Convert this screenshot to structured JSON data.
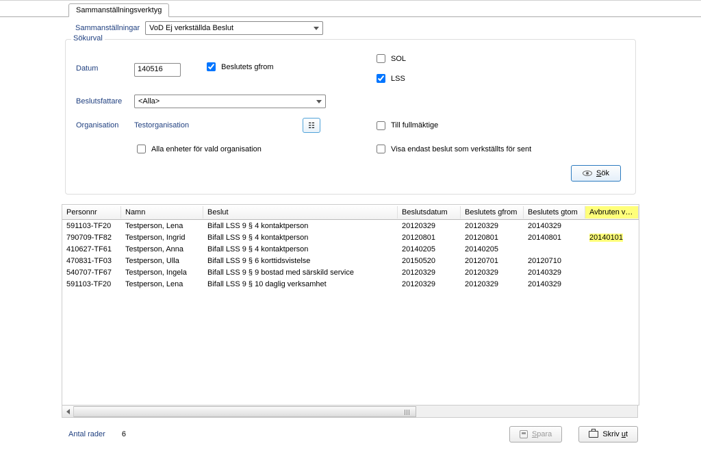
{
  "tab": {
    "title": "Sammanställningsverktyg"
  },
  "toolbar": {
    "compilations_label": "Sammanställningar",
    "compilations_value": "VoD Ej verkställda Beslut"
  },
  "search": {
    "group_title": "Sökurval",
    "date_label": "Datum",
    "date_value": "140516",
    "beslutets_gfrom_label": "Beslutets gfrom",
    "beslutets_gfrom_checked": true,
    "sol_label": "SOL",
    "sol_checked": false,
    "lss_label": "LSS",
    "lss_checked": true,
    "beslutsfattare_label": "Beslutsfattare",
    "beslutsfattare_value": "<Alla>",
    "organisation_label": "Organisation",
    "organisation_link": "Testorganisation",
    "all_units_label": "Alla enheter för vald organisation",
    "all_units_checked": false,
    "till_fullmaktige_label": "Till fullmäktige",
    "till_fullmaktige_checked": false,
    "visa_endast_label": "Visa endast beslut som verkställts för sent",
    "visa_endast_checked": false,
    "search_btn_label": "Sök",
    "search_btn_hotkey": "S"
  },
  "grid": {
    "columns": [
      "Personnr",
      "Namn",
      "Beslut",
      "Beslutsdatum",
      "Beslutets gfrom",
      "Beslutets gtom",
      "Avbruten verkställighet"
    ],
    "highlight_column_index": 6,
    "rows": [
      {
        "personnr": "591103-TF20",
        "namn": "Testperson, Lena",
        "beslut": "Bifall LSS 9 § 4 kontaktperson",
        "beslutsdatum": "20120329",
        "gfrom": "20120329",
        "gtom": "20140329",
        "avbruten": ""
      },
      {
        "personnr": "790709-TF82",
        "namn": "Testperson, Ingrid",
        "beslut": "Bifall LSS 9 § 4 kontaktperson",
        "beslutsdatum": "20120801",
        "gfrom": "20120801",
        "gtom": "20140801",
        "avbruten": "20140101",
        "highlight": true
      },
      {
        "personnr": "410627-TF61",
        "namn": "Testperson,  Anna",
        "beslut": "Bifall LSS 9 § 4 kontaktperson",
        "beslutsdatum": "20140205",
        "gfrom": "20140205",
        "gtom": "",
        "avbruten": ""
      },
      {
        "personnr": "470831-TF03",
        "namn": "Testperson, Ulla",
        "beslut": "Bifall LSS 9 § 6 korttidsvistelse",
        "beslutsdatum": "20150520",
        "gfrom": "20120701",
        "gtom": "20120710",
        "avbruten": ""
      },
      {
        "personnr": "540707-TF67",
        "namn": "Testperson, Ingela",
        "beslut": "Bifall LSS 9 § 9 bostad med särskild service",
        "beslutsdatum": "20120329",
        "gfrom": "20120329",
        "gtom": "20140329",
        "avbruten": ""
      },
      {
        "personnr": "591103-TF20",
        "namn": "Testperson, Lena",
        "beslut": "Bifall LSS 9 § 10 daglig verksamhet",
        "beslutsdatum": "20120329",
        "gfrom": "20120329",
        "gtom": "20140329",
        "avbruten": ""
      }
    ]
  },
  "status": {
    "count_label": "Antal rader",
    "count_value": "6",
    "save_label": "Spara",
    "print_label": "Skriv ut",
    "print_pre": "Skriv ",
    "print_hot": "u",
    "print_post": "t"
  }
}
